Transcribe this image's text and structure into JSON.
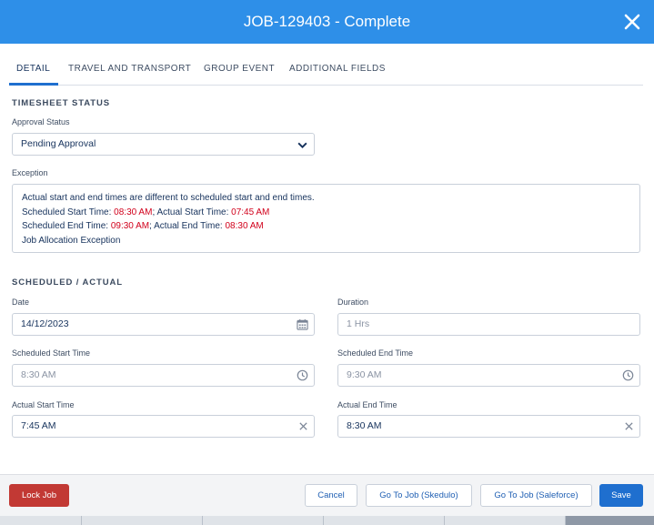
{
  "header": {
    "title": "JOB-129403 - Complete"
  },
  "tabs": [
    {
      "label": "DETAIL"
    },
    {
      "label": "TRAVEL AND TRANSPORT"
    },
    {
      "label": "GROUP EVENT"
    },
    {
      "label": "ADDITIONAL FIELDS"
    }
  ],
  "timesheet": {
    "title": "TIMESHEET STATUS",
    "approval_label": "Approval Status",
    "approval_value": "Pending Approval",
    "exception_label": "Exception",
    "exception": {
      "line1": "Actual start and end times are different to scheduled start and end times.",
      "sched_start_label": "Scheduled Start Time: ",
      "sched_start_value": "08:30 AM",
      "actual_start_label": "; Actual Start Time: ",
      "actual_start_value": "07:45 AM",
      "sched_end_label": "Scheduled End Time: ",
      "sched_end_value": "09:30 AM",
      "actual_end_label": "; Actual End Time: ",
      "actual_end_value": "08:30 AM",
      "line4": "Job Allocation Exception"
    }
  },
  "scheduled": {
    "title": "SCHEDULED / ACTUAL",
    "date_label": "Date",
    "date_value": "14/12/2023",
    "duration_label": "Duration",
    "duration_value": "1 Hrs",
    "sched_start_label": "Scheduled Start Time",
    "sched_start_value": "8:30 AM",
    "sched_end_label": "Scheduled End Time",
    "sched_end_value": "9:30 AM",
    "actual_start_label": "Actual Start Time",
    "actual_start_value": "7:45 AM",
    "actual_end_label": "Actual End Time",
    "actual_end_value": "8:30 AM"
  },
  "footer": {
    "lock": "Lock Job",
    "cancel": "Cancel",
    "skedulo": "Go To Job (Skedulo)",
    "salesforce": "Go To Job (Saleforce)",
    "save": "Save"
  },
  "colors": {
    "header": "#2e8fe8",
    "brand": "#1f6fcf",
    "danger": "#c23934",
    "exception_red": "#d1001b"
  }
}
